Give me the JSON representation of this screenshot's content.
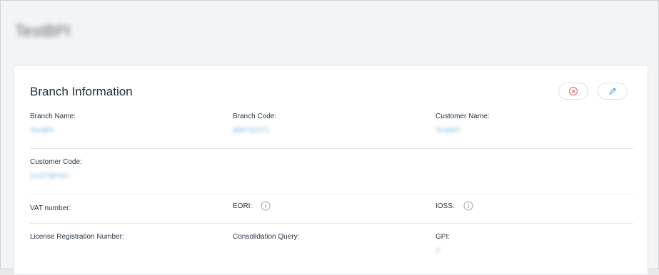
{
  "page": {
    "title": "TestBPI"
  },
  "card": {
    "title": "Branch Information",
    "actions": {
      "cancel_icon": "close-circle-icon",
      "edit_icon": "pencil-icon"
    }
  },
  "fields": {
    "branch_name": {
      "label": "Branch Name:",
      "value": "TestBPI"
    },
    "branch_code": {
      "label": "Branch Code:",
      "value": "BBPTEST1"
    },
    "customer_name": {
      "label": "Customer Name:",
      "value": "TestBPI"
    },
    "customer_code": {
      "label": "Customer Code:",
      "value": "CUSTBPI01"
    },
    "vat_number": {
      "label": "VAT number:",
      "value": ""
    },
    "eori": {
      "label": "EORI:",
      "value": ""
    },
    "ioss": {
      "label": "IOSS:",
      "value": ""
    },
    "license_registration_number": {
      "label": "License Registration Number:",
      "value": ""
    },
    "consolidation_query": {
      "label": "Consolidation Query:",
      "value": ""
    },
    "gpi": {
      "label": "GPI:",
      "value": "Y"
    }
  },
  "colors": {
    "accent_blue": "#5aa8d8",
    "cancel_red": "#e07a7a",
    "text_dark": "#1f2b36"
  }
}
